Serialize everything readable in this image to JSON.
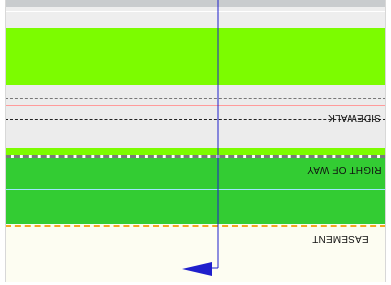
{
  "labels": {
    "sidewalk": "SIDEWALK",
    "right_of_way": "RIGHT OF WAY",
    "easement": "EASEMENT"
  },
  "colors": {
    "lime_green": "#7cfc00",
    "medium_green": "#33cc33",
    "sidewalk_gray": "#ececec",
    "top_gray": "#c9ccce",
    "easement_cream": "#fdfdf2",
    "axis_blue": "#1f1fcc",
    "easement_orange": "#f5a623"
  },
  "icons": {
    "axis_arrow": "blue-axis-arrow-icon"
  }
}
